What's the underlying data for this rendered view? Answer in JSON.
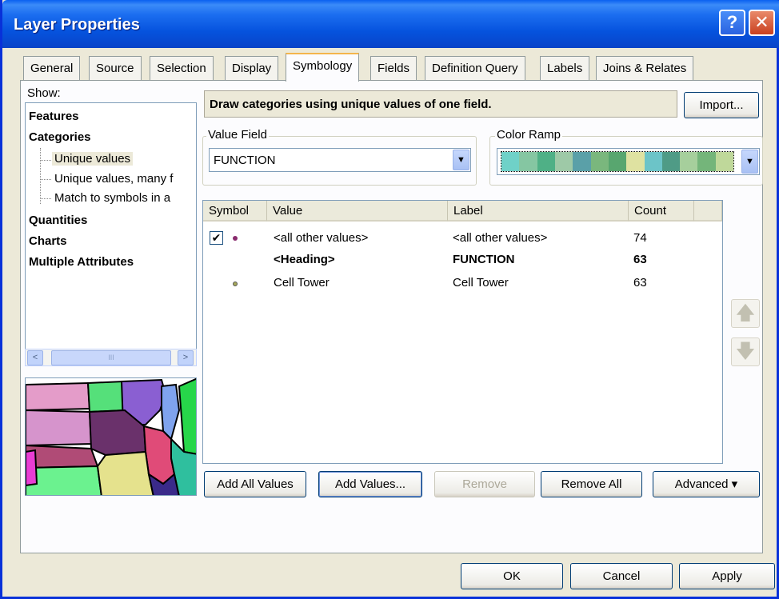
{
  "window": {
    "title": "Layer Properties",
    "help_glyph": "?",
    "close_glyph": "✕"
  },
  "tabs": [
    {
      "label": "General"
    },
    {
      "label": "Source"
    },
    {
      "label": "Selection"
    },
    {
      "label": "Display"
    },
    {
      "label": "Symbology"
    },
    {
      "label": "Fields"
    },
    {
      "label": "Definition Query"
    },
    {
      "label": "Labels"
    },
    {
      "label": "Joins & Relates"
    }
  ],
  "show": {
    "label": "Show:",
    "tree": {
      "features": "Features",
      "categories": "Categories",
      "unique_values": "Unique values",
      "unique_values_many": "Unique values, many f",
      "match_symbols": "Match to symbols in a",
      "quantities": "Quantities",
      "charts": "Charts",
      "multiple_attributes": "Multiple Attributes"
    },
    "scroll_left": "<",
    "scroll_right": ">",
    "scroll_grip": "III"
  },
  "symbology": {
    "description": "Draw categories using unique values of one field.",
    "import_label": "Import...",
    "value_field_label": "Value Field",
    "value_field_value": "FUNCTION",
    "color_ramp_label": "Color Ramp",
    "dropdown_glyph": "▼",
    "color_ramp_colors": [
      "#6fd1c8",
      "#85c6a2",
      "#4fb086",
      "#9ec9a7",
      "#5aa0a8",
      "#7ab77d",
      "#58a66f",
      "#dfe2a1",
      "#6cc4c8",
      "#4f9b86",
      "#a6cf9c",
      "#74b57a",
      "#bfd89a"
    ],
    "table": {
      "headers": {
        "symbol": "Symbol",
        "value": "Value",
        "label": "Label",
        "count": "Count"
      },
      "rows": [
        {
          "checked": true,
          "value": "<all other values>",
          "label": "<all other values>",
          "count": "74",
          "bold": false,
          "dot_color": "#8a2b6e"
        },
        {
          "checked": false,
          "value": "<Heading>",
          "label": "FUNCTION",
          "count": "63",
          "bold": true,
          "dot_color": ""
        },
        {
          "checked": false,
          "value": "Cell Tower",
          "label": "Cell Tower",
          "count": "63",
          "bold": false,
          "dot_color": "#a6a85a"
        }
      ],
      "check_glyph": "✔"
    },
    "move_up_glyph": "🡅",
    "move_down_glyph": "🡇",
    "buttons": {
      "add_all_values": "Add All Values",
      "add_values": "Add Values...",
      "remove": "Remove",
      "remove_all": "Remove All",
      "advanced": "Advanced",
      "advanced_caret": "▾"
    }
  },
  "footer": {
    "ok": "OK",
    "cancel": "Cancel",
    "apply": "Apply"
  }
}
